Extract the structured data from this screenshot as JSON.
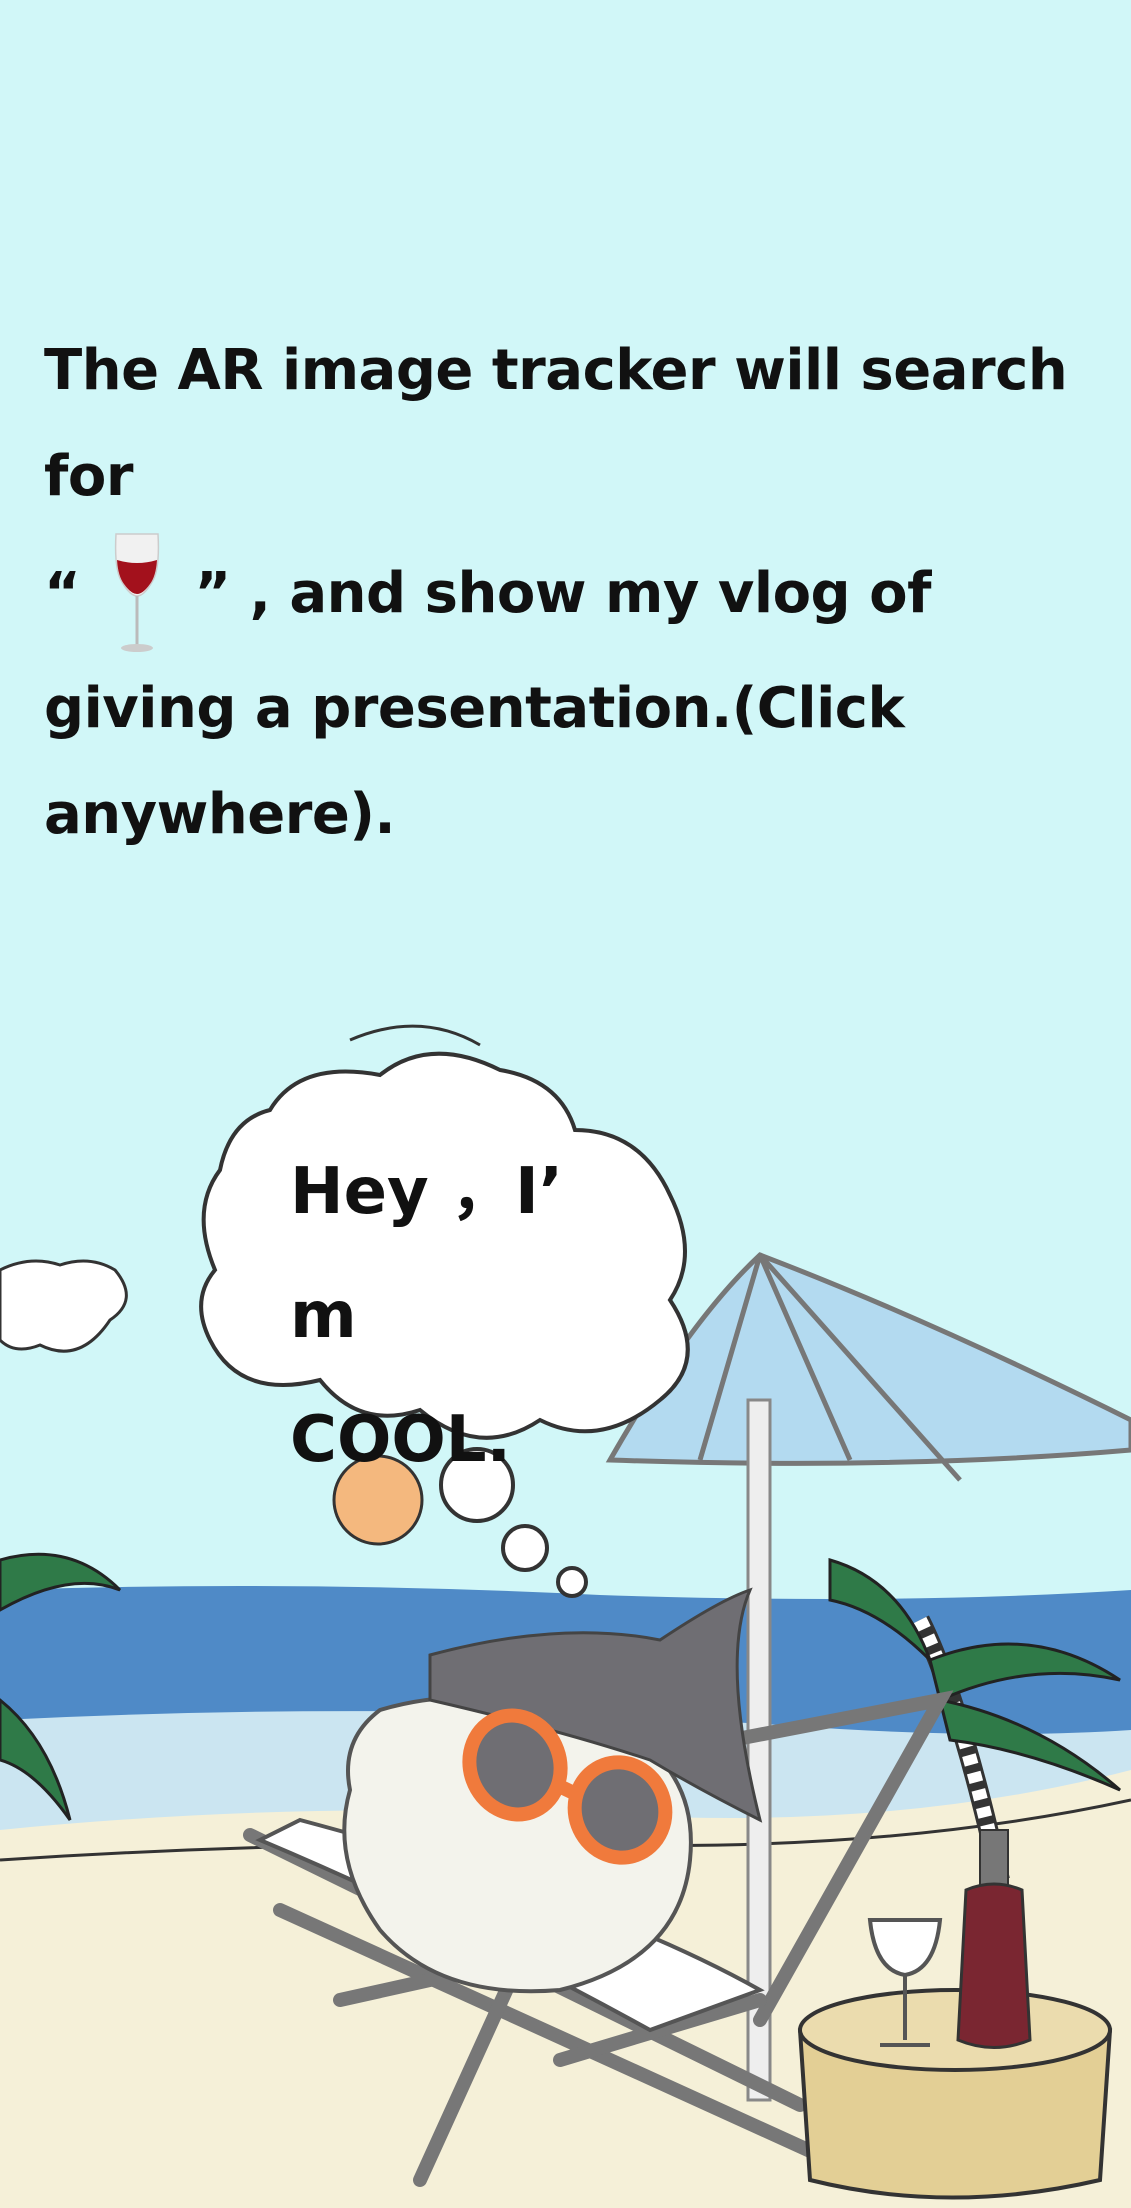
{
  "intro": {
    "line_start": "The AR image tracker will search for",
    "open_quote": "“",
    "close_quote": "”",
    "line_end": ", and show my vlog of giving a presentation.(Click anywhere).",
    "marker_icon": "wine-glass-icon"
  },
  "speech_bubble": {
    "line1": "Hey ，I’ m",
    "line2": "COOL."
  },
  "colors": {
    "sky": "#d1f7f8",
    "sea": "#4f8ac7",
    "sand": "#f5f0d8",
    "umbrella": "#b3daf0",
    "palm": "#2f7a48",
    "sunglasses": "#f07a3c",
    "hat": "#6f6e73",
    "wine": "#7a2631"
  }
}
